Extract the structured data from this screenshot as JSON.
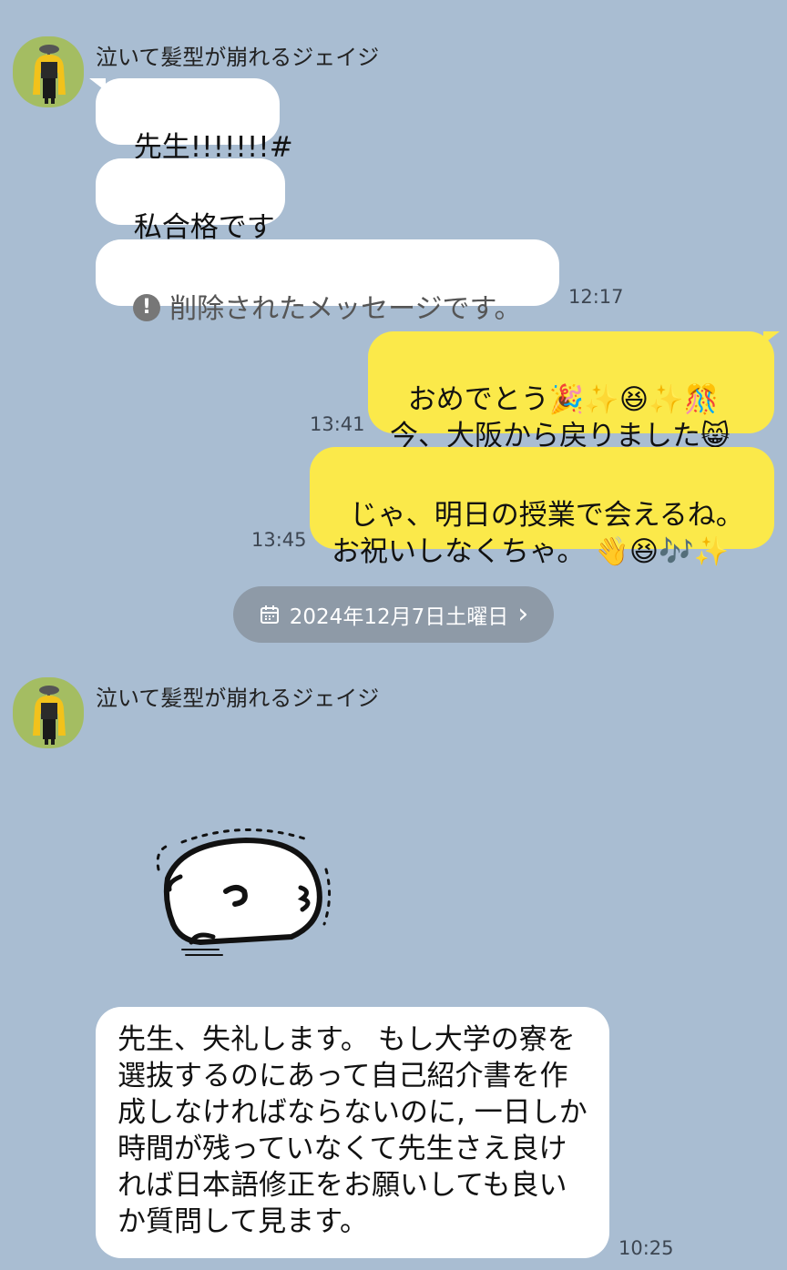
{
  "first_group": {
    "sender_name": "泣いて髪型が崩れるジェイジ",
    "messages": [
      {
        "text": "先生!!!!!!!#"
      },
      {
        "text": "私合格です"
      },
      {
        "deleted_text": "削除されたメッセージです。",
        "icon": "alert-circle-icon",
        "time": "12:17"
      }
    ]
  },
  "outgoing": [
    {
      "text": "おめでとう🎉✨😆✨🎊\n今、大阪から戻りました😸",
      "time": "13:41"
    },
    {
      "text": "じゃ、明日の授業で会えるね。\nお祝いしなくちゃ。 👋😆🎶✨",
      "time": "13:45"
    }
  ],
  "date_separator": {
    "label": "2024年12月7日土曜日",
    "icon": "calendar-icon",
    "chevron": "›"
  },
  "second_group": {
    "sender_name": "泣いて髪型が崩れるジェイジ",
    "sticker": "sleeping-blob-sticker",
    "message": {
      "text": " 先生、失礼します。 もし大学の寮を選抜するのにあって自己紹介書を作成しなければならないのに, 一日しか時間が残っていなくて先生さえ良ければ日本語修正をお願いしても良いか質問して見ます。",
      "time": "10:25"
    }
  },
  "colors": {
    "background": "#a9bdd2",
    "incoming_bubble": "#ffffff",
    "outgoing_bubble": "#fbe94a",
    "date_pill": "#8e9aa7",
    "avatar_bg": "#a4bd62"
  }
}
